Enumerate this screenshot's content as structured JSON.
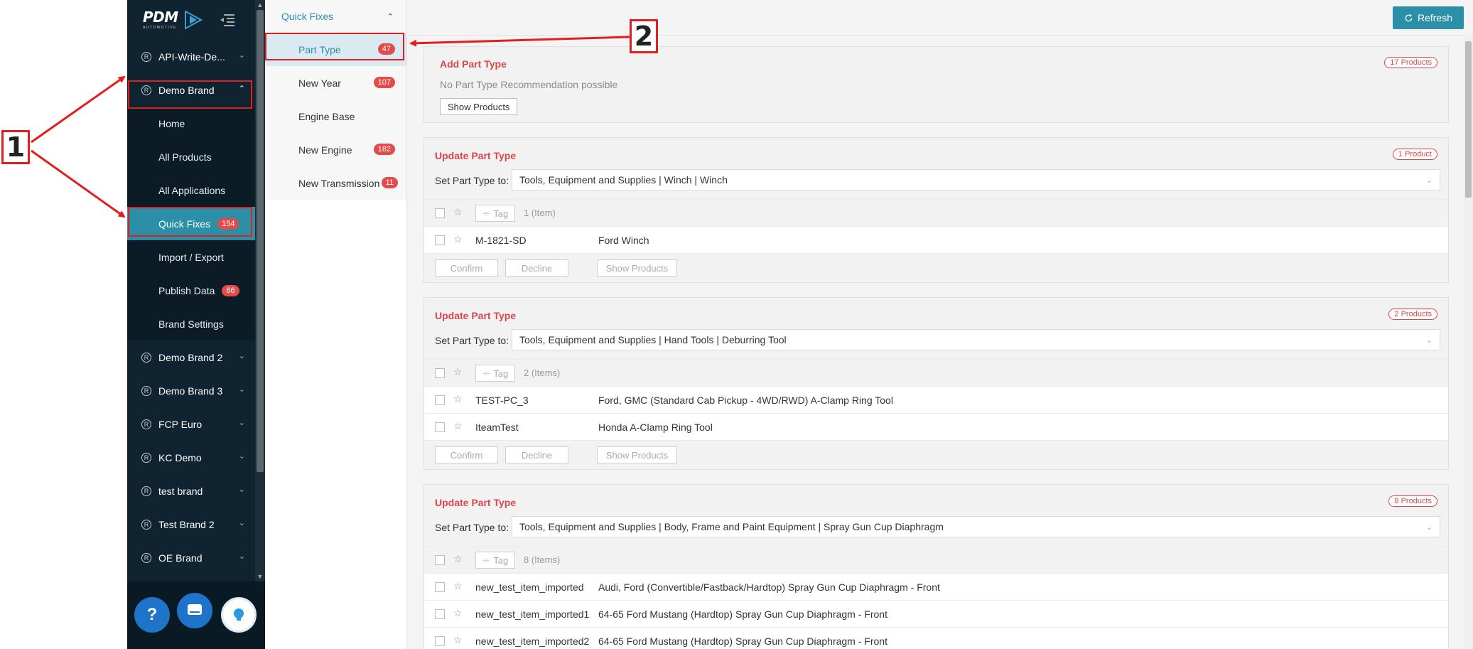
{
  "nav": {
    "logo": "PDM",
    "logo_sub": "AUTOMOTIVE",
    "brands_top": [
      {
        "label": "API-Write-De..."
      }
    ],
    "active_brand": {
      "label": "Demo Brand"
    },
    "sub_items": [
      {
        "label": "Home"
      },
      {
        "label": "All Products"
      },
      {
        "label": "All Applications"
      },
      {
        "label": "Quick Fixes",
        "badge": "154"
      },
      {
        "label": "Import / Export"
      },
      {
        "label": "Publish Data",
        "badge": "66"
      },
      {
        "label": "Brand Settings"
      }
    ],
    "brands_bottom": [
      {
        "label": "Demo Brand 2"
      },
      {
        "label": "Demo Brand 3"
      },
      {
        "label": "FCP Euro"
      },
      {
        "label": "KC Demo"
      },
      {
        "label": "test brand"
      },
      {
        "label": "Test Brand 2"
      },
      {
        "label": "OE Brand"
      }
    ],
    "help_glyph": "?"
  },
  "subpanel": {
    "header": "Quick Fixes",
    "items": [
      {
        "label": "Part Type",
        "badge": "47"
      },
      {
        "label": "New Year",
        "badge": "107"
      },
      {
        "label": "Engine Base"
      },
      {
        "label": "New Engine",
        "badge": "182"
      },
      {
        "label": "New Transmission",
        "badge": "11"
      }
    ]
  },
  "toolbar": {
    "refresh_label": "Refresh"
  },
  "cards": {
    "add": {
      "title": "Add Part Type",
      "badge": "17 Products",
      "message": "No Part Type Recommendation possible",
      "show_label": "Show Products"
    },
    "c1": {
      "title": "Update Part Type",
      "badge": "1 Product",
      "set_label": "Set Part Type to:",
      "value": "Tools, Equipment and Supplies | Winch | Winch",
      "tag": "Tag",
      "count": "1 (Item)",
      "rows": [
        {
          "part": "M-1821-SD",
          "desc": "Ford Winch"
        }
      ]
    },
    "c2": {
      "title": "Update Part Type",
      "badge": "2 Products",
      "set_label": "Set Part Type to:",
      "value": "Tools, Equipment and Supplies | Hand Tools | Deburring Tool",
      "tag": "Tag",
      "count": "2 (Items)",
      "rows": [
        {
          "part": "TEST-PC_3",
          "desc": "Ford, GMC (Standard Cab Pickup - 4WD/RWD) A-Clamp Ring Tool"
        },
        {
          "part": "IteamTest",
          "desc": "Honda A-Clamp Ring Tool"
        }
      ]
    },
    "c3": {
      "title": "Update Part Type",
      "badge": "8 Products",
      "set_label": "Set Part Type to:",
      "value": "Tools, Equipment and Supplies | Body, Frame and Paint Equipment | Spray Gun Cup Diaphragm",
      "tag": "Tag",
      "count": "8 (Items)",
      "rows": [
        {
          "part": "new_test_item_imported",
          "desc": "Audi, Ford (Convertible/Fastback/Hardtop) Spray Gun Cup Diaphragm - Front"
        },
        {
          "part": "new_test_item_imported1",
          "desc": "64-65 Ford Mustang (Hardtop) Spray Gun Cup Diaphragm - Front"
        },
        {
          "part": "new_test_item_imported2",
          "desc": "64-65 Ford Mustang (Hardtop) Spray Gun Cup Diaphragm - Front"
        }
      ]
    },
    "actions": {
      "confirm": "Confirm",
      "decline": "Decline",
      "show": "Show Products"
    }
  },
  "annotations": {
    "one": "1",
    "two": "2"
  },
  "colors": {
    "nav_bg": "#0f2430",
    "accent": "#2b8fa8",
    "badge_red": "#e34b4b",
    "title_red": "#d9474b",
    "annotation_red": "#e02020"
  },
  "icons": [
    "registered-icon",
    "chevron-down-icon",
    "chevron-up-icon",
    "menu-collapse-icon",
    "refresh-icon",
    "star-icon",
    "tag-icon",
    "help-icon",
    "chat-icon",
    "bulb-icon"
  ]
}
